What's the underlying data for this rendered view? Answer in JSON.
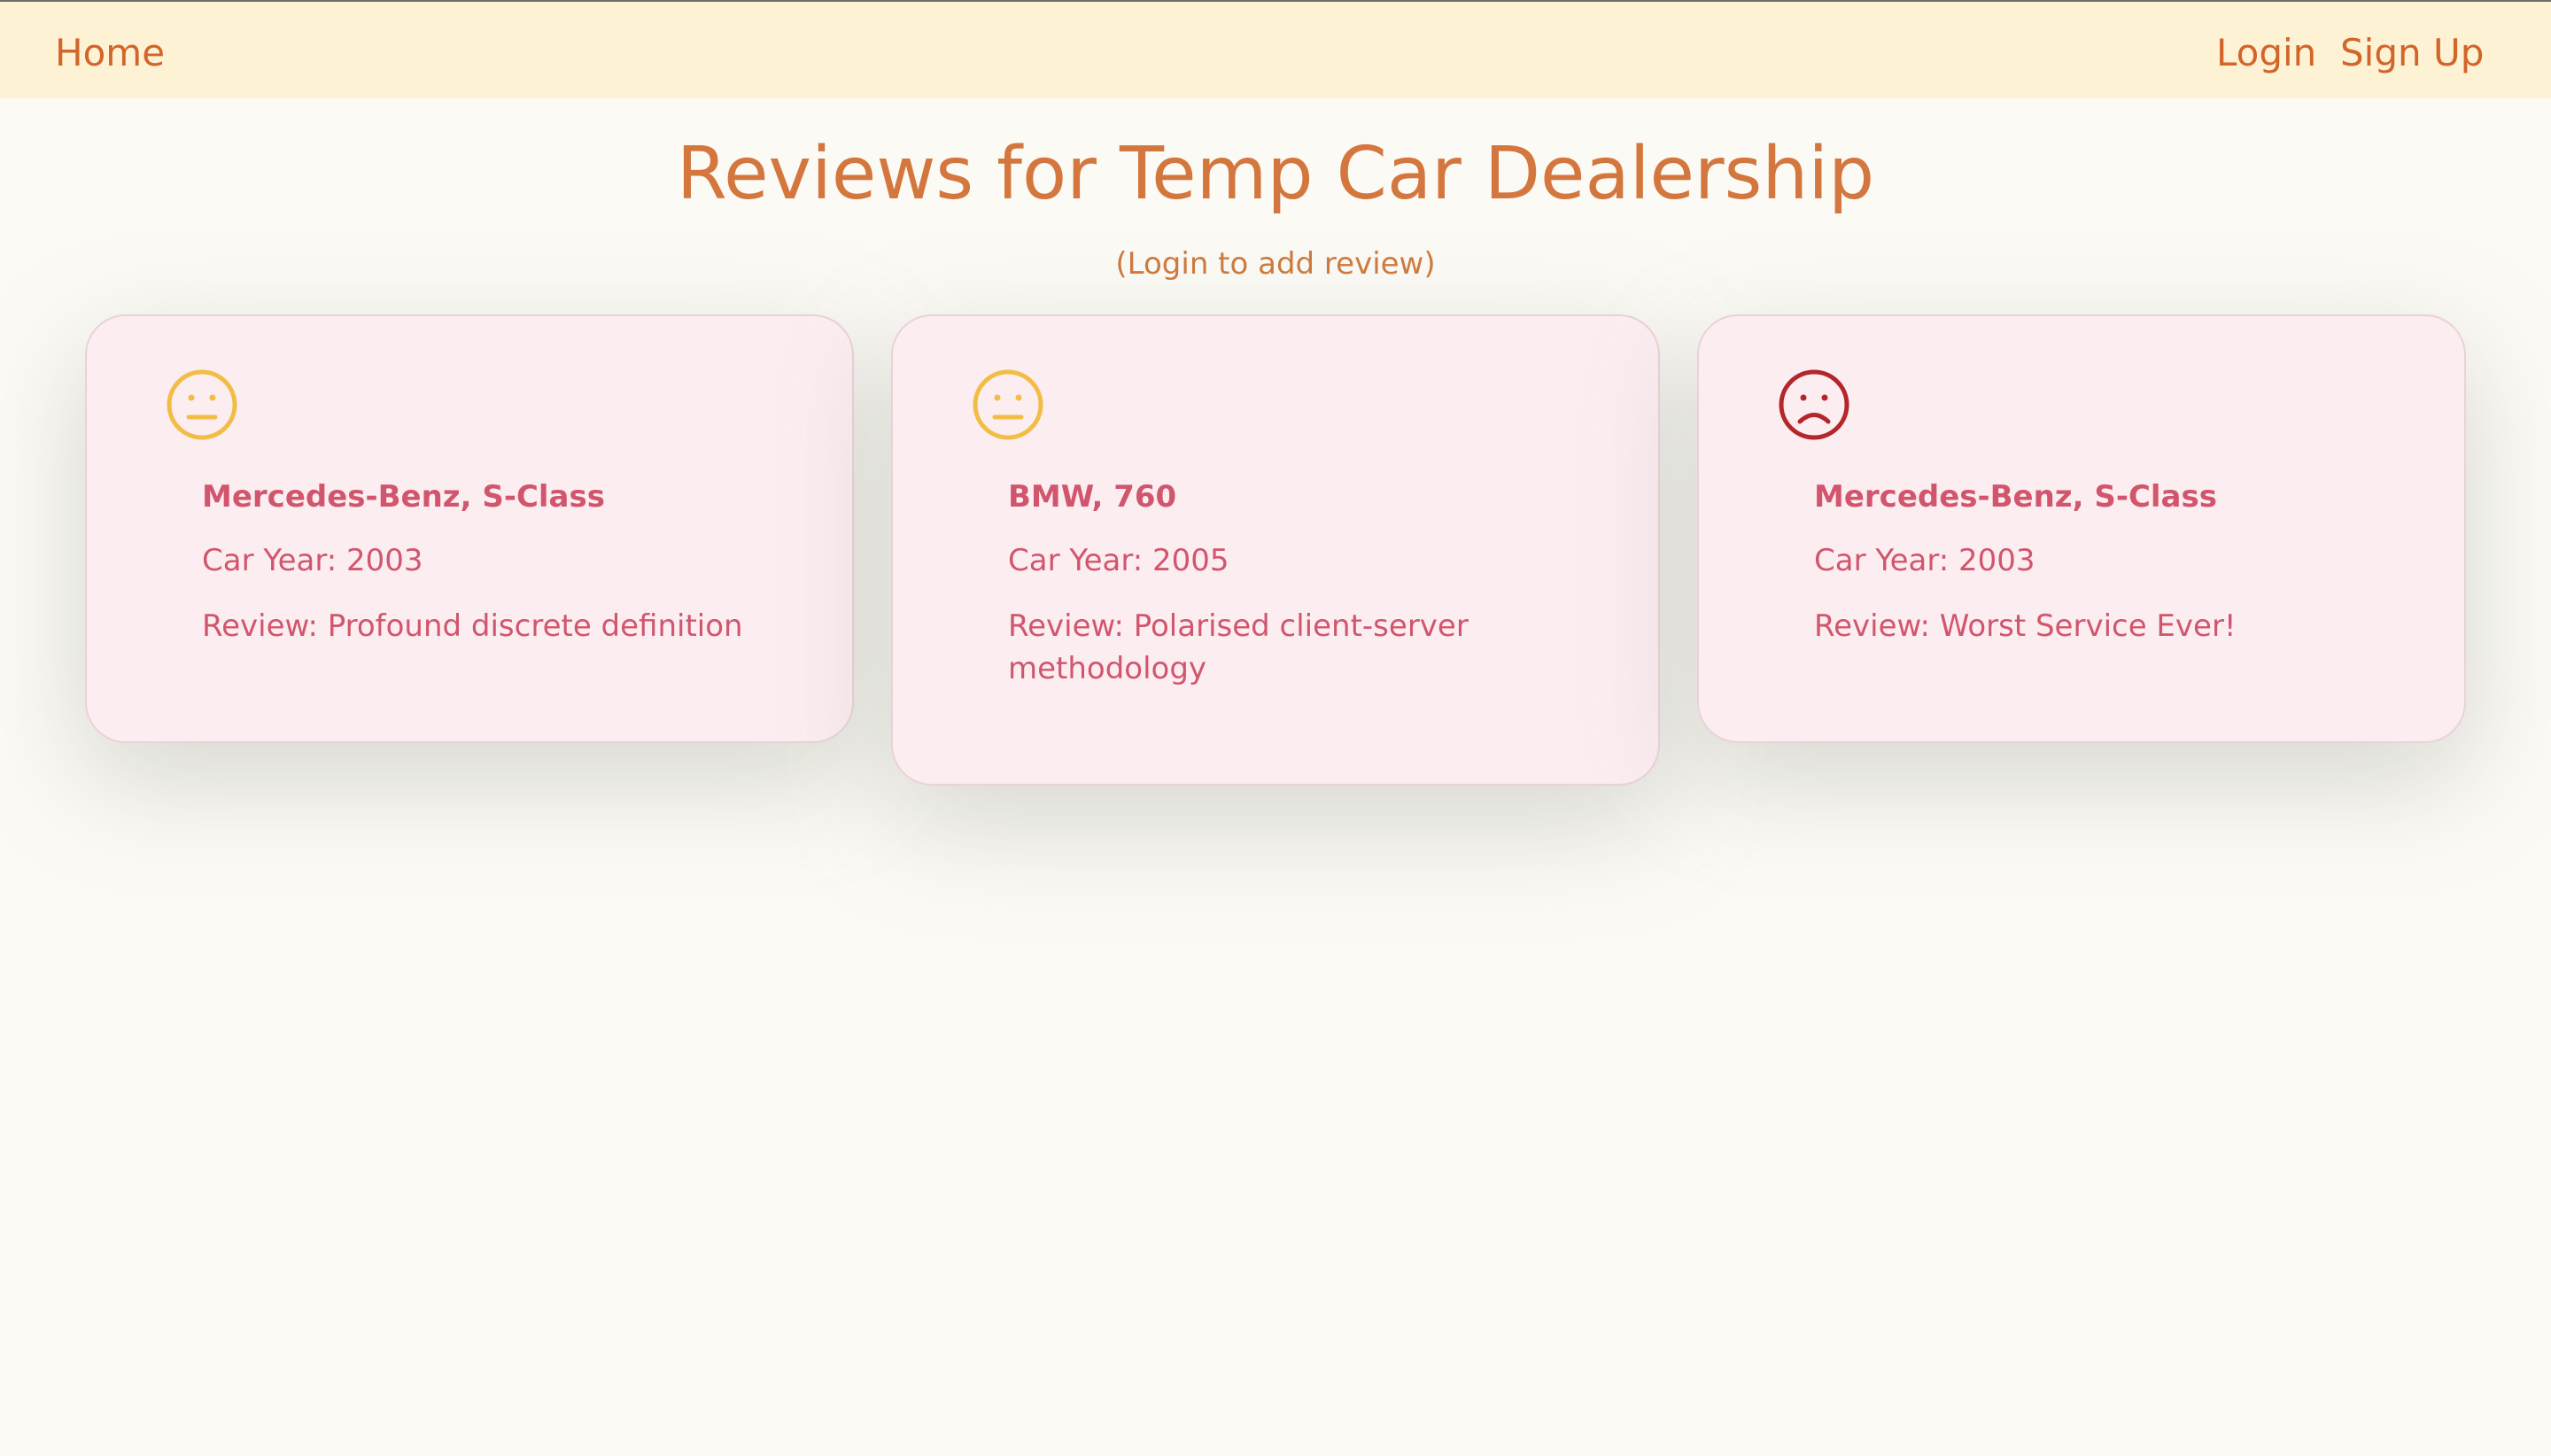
{
  "nav": {
    "home_label": "Home",
    "login_label": "Login",
    "signup_label": "Sign Up"
  },
  "page": {
    "title": "Reviews for Temp Car Dealership",
    "login_hint": "(Login to add review)"
  },
  "reviews": [
    {
      "sentiment_icon": "neutral-face-icon",
      "icon_color": "#f2bd45",
      "car": "Mercedes-Benz, S-Class",
      "year": "Car Year: 2003",
      "review": "Review: Profound discrete definition"
    },
    {
      "sentiment_icon": "neutral-face-icon",
      "icon_color": "#f2bd45",
      "car": "BMW, 760",
      "year": "Car Year: 2005",
      "review": "Review: Polarised client-server methodology"
    },
    {
      "sentiment_icon": "sad-face-icon",
      "icon_color": "#b3262a",
      "car": "Mercedes-Benz, S-Class",
      "year": "Car Year: 2003",
      "review": "Review: Worst Service Ever!"
    }
  ],
  "colors": {
    "nav_bg": "#fdf2d4",
    "nav_link": "#d2652a",
    "title": "#d4773f",
    "card_bg": "#fcedf1",
    "card_text": "#d1566d",
    "page_bg": "#fbfaf5"
  }
}
